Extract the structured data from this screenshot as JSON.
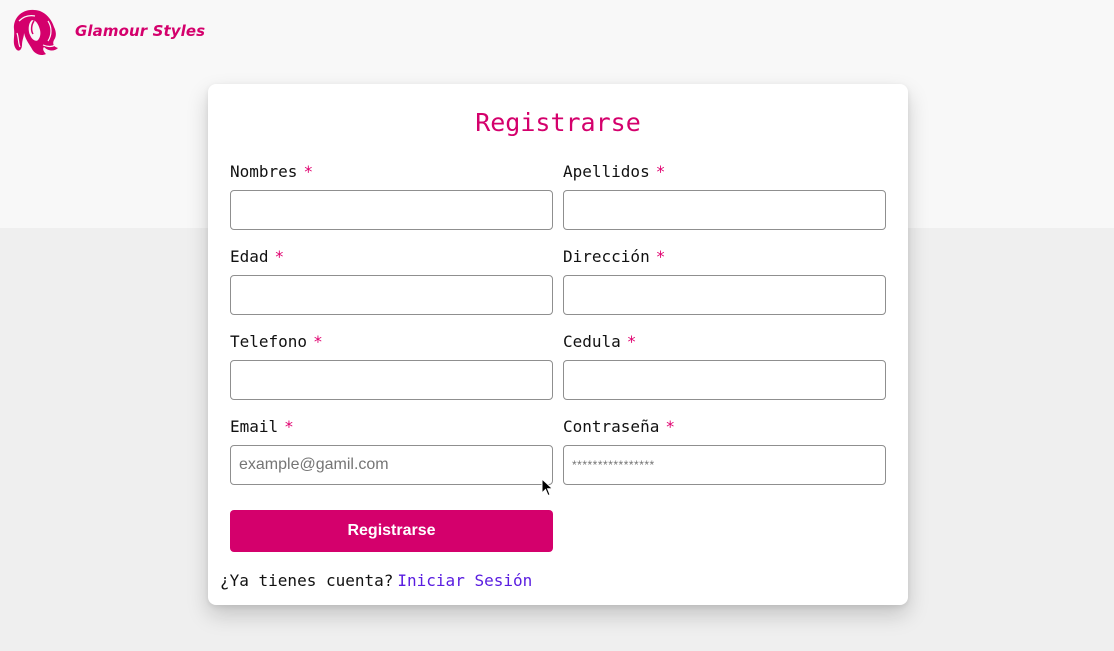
{
  "brand": {
    "name": "Glamour Styles",
    "logo_icon": "woman-hair-logo-icon",
    "color": "#d4006c"
  },
  "form": {
    "title": "Registrarse",
    "required_marker": "*",
    "fields": {
      "nombres": {
        "label": "Nombres",
        "value": "",
        "placeholder": ""
      },
      "apellidos": {
        "label": "Apellidos",
        "value": "",
        "placeholder": ""
      },
      "edad": {
        "label": "Edad",
        "value": "",
        "placeholder": ""
      },
      "direccion": {
        "label": "Dirección",
        "value": "",
        "placeholder": ""
      },
      "telefono": {
        "label": "Telefono",
        "value": "",
        "placeholder": ""
      },
      "cedula": {
        "label": "Cedula",
        "value": "",
        "placeholder": ""
      },
      "email": {
        "label": "Email",
        "value": "",
        "placeholder": "example@gamil.com"
      },
      "contrasena": {
        "label": "Contraseña",
        "value": "",
        "placeholder": "****************"
      }
    },
    "submit_label": "Registrarse",
    "login_prompt": "¿Ya tienes cuenta?",
    "login_link": "Iniciar Sesión"
  },
  "colors": {
    "accent": "#d4006c",
    "link": "#5a1de0",
    "required": "#e0006f"
  }
}
